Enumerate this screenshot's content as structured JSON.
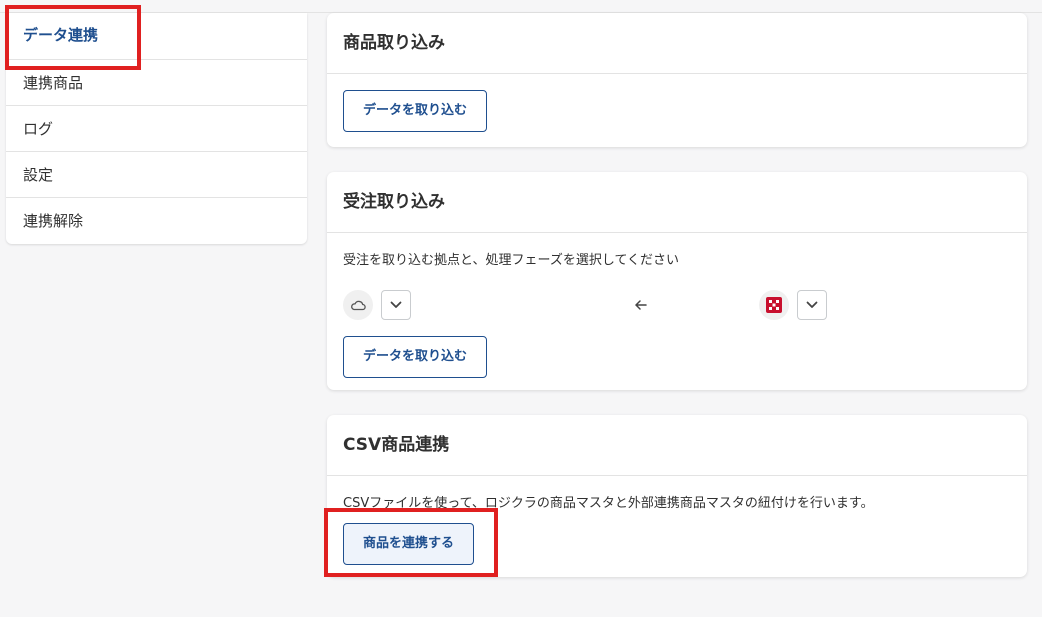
{
  "sidebar": {
    "items": [
      {
        "label": "データ連携"
      },
      {
        "label": "連携商品"
      },
      {
        "label": "ログ"
      },
      {
        "label": "設定"
      },
      {
        "label": "連携解除"
      }
    ]
  },
  "product_import": {
    "title": "商品取り込み",
    "button": "データを取り込む"
  },
  "order_import": {
    "title": "受注取り込み",
    "description": "受注を取り込む拠点と、処理フェーズを選択してください",
    "button": "データを取り込む"
  },
  "csv_link": {
    "title": "CSV商品連携",
    "description": "CSVファイルを使って、ロジクラの商品マスタと外部連携商品マスタの紐付けを行います。",
    "button": "商品を連携する"
  },
  "colors": {
    "accent": "#1f4f8f",
    "highlight": "#e02020",
    "logo_red": "#c8102e"
  }
}
